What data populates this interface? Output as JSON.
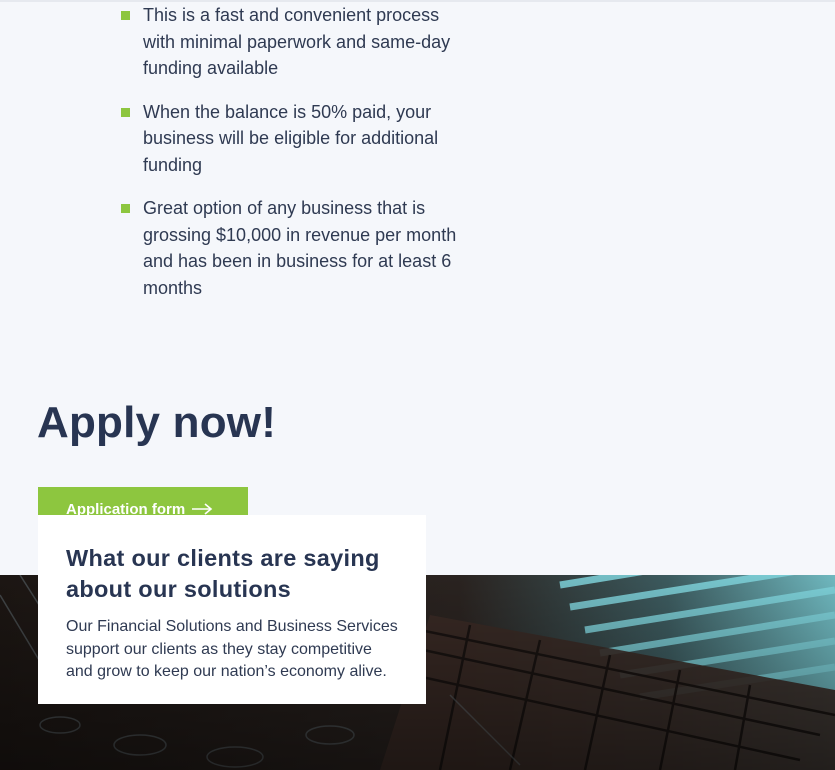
{
  "benefits": [
    "This is a fast and convenient process with minimal paperwork and same-day funding available",
    "When the balance is 50% paid, your business will be eligible for additional funding",
    "Great option of any business that is grossing $10,000 in revenue per month and has been in business for at least 6 months"
  ],
  "apply": {
    "title": "Apply now!",
    "button_label": "Application form",
    "button_icon": "arrow-right-icon"
  },
  "testimonials": {
    "title": "What our clients are saying about our solutions",
    "body": "Our Financial Solutions and Business Services support our clients as they stay competitive and grow to keep our nation’s economy alive."
  },
  "colors": {
    "accent": "#8dc63f",
    "heading": "#283552",
    "page_background": "#f5f7fb"
  }
}
